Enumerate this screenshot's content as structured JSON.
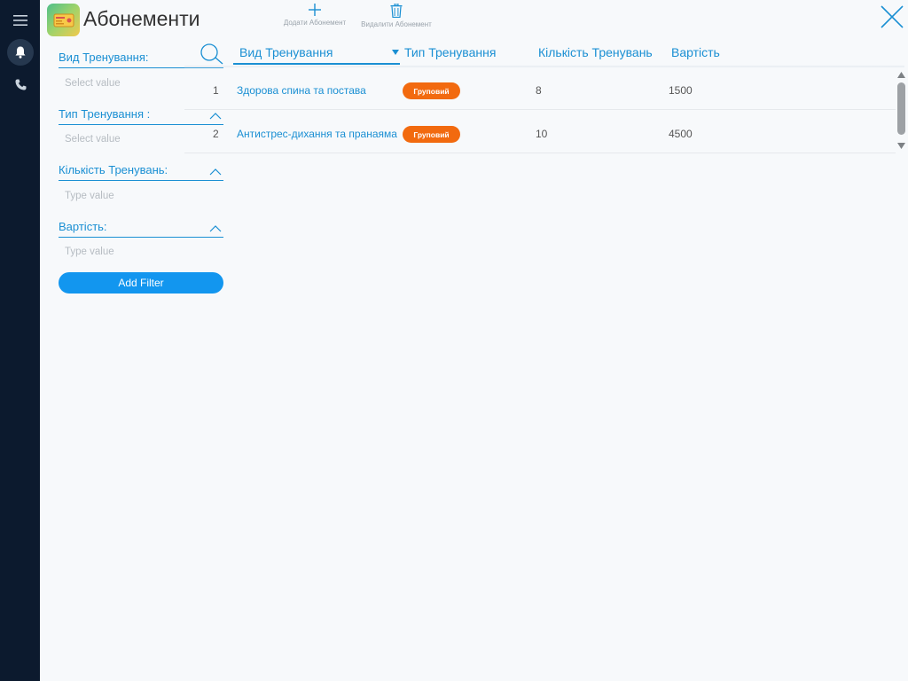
{
  "app": {
    "title": "Абонементи",
    "icon": "ticket-icon",
    "accent_color": "#1a8fd3"
  },
  "toolbar": {
    "add_label": "Додати Абонемент",
    "delete_label": "Видалити Абонемент"
  },
  "rail": {
    "items": [
      "menu-icon",
      "bell-icon",
      "phone-icon"
    ]
  },
  "filters": [
    {
      "label": "Вид Тренування:",
      "placeholder": "Select value"
    },
    {
      "label": "Тип Тренування :",
      "placeholder": "Select value"
    },
    {
      "label": "Кількість Тренувань:",
      "placeholder": "Type value"
    },
    {
      "label": "Вартість:",
      "placeholder": "Type value"
    }
  ],
  "add_filter_label": "Add Filter",
  "table": {
    "columns": [
      "Вид Тренування",
      "Тип Тренування",
      "Кількість Тренувань",
      "Вартість"
    ],
    "sorted_column": "Вид Тренування",
    "rows": [
      {
        "index": "1",
        "name": "Здорова спина та постава",
        "type": "Груповий",
        "count": "8",
        "price": "1500"
      },
      {
        "index": "2",
        "name": "Антистрес-дихання та пранаяма",
        "type": "Груповий",
        "count": "10",
        "price": "4500"
      }
    ],
    "badge_color": "#f26a0f"
  }
}
